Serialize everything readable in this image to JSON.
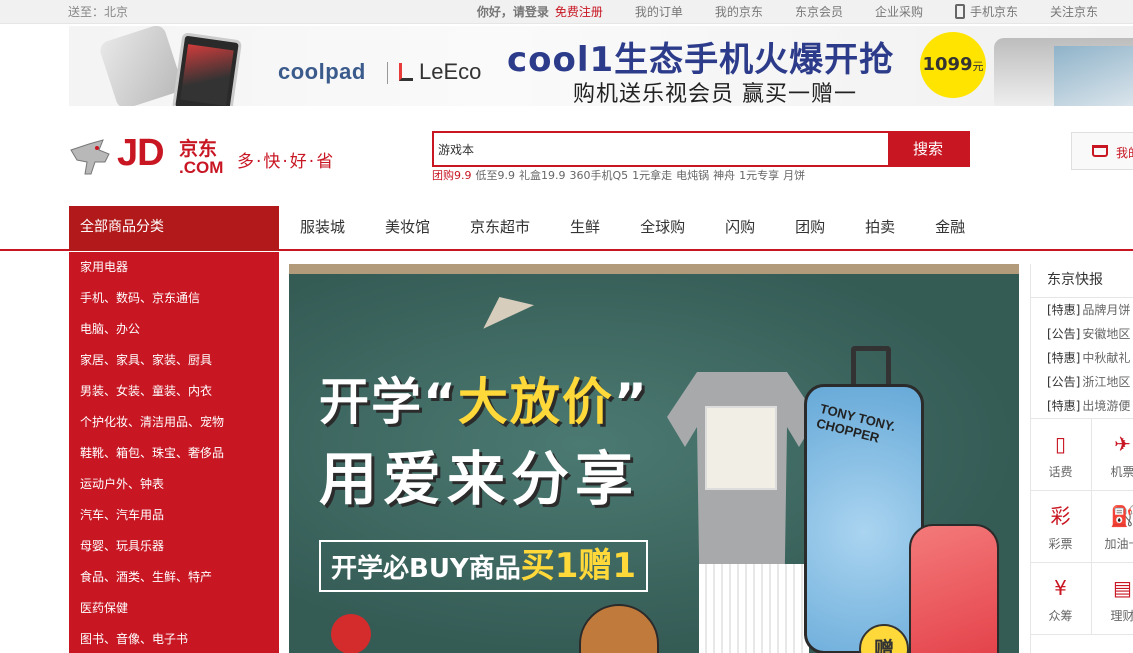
{
  "topbar": {
    "location_label": "送至：北京",
    "greeting": "你好，请登录",
    "register": "免费注册",
    "my_orders": "我的订单",
    "my_jd": "我的京东",
    "member": "东京会员",
    "enterprise": "企业采购",
    "mobile": "手机京东",
    "follow": "关注京东"
  },
  "banner": {
    "brand1": "coolpad",
    "brand2": "LeEco",
    "headline": "cool1生态手机火爆开抢",
    "subline": "购机送乐视会员 赢买一赠一",
    "price": "1099",
    "price_unit": "元"
  },
  "logo": {
    "jd": "JD",
    "cn": "京东",
    "com": ".COM",
    "slogan": "多·快·好·省"
  },
  "search": {
    "value": "游戏本",
    "button": "搜索",
    "hotwords": [
      "团购9.9",
      "低至9.9",
      "礼盒19.9",
      "360手机Q5",
      "1元拿走",
      "电炖锅",
      "神舟",
      "1元专享",
      "月饼"
    ]
  },
  "cart": {
    "label": "我的"
  },
  "nav": {
    "all_categories": "全部商品分类",
    "items": [
      "服装城",
      "美妆馆",
      "京东超市",
      "生鲜",
      "全球购",
      "闪购",
      "团购",
      "拍卖",
      "金融"
    ]
  },
  "categories": [
    "家用电器",
    "手机、数码、京东通信",
    "电脑、办公",
    "家居、家具、家装、厨具",
    "男装、女装、童装、内衣",
    "个护化妆、清洁用品、宠物",
    "鞋靴、箱包、珠宝、奢侈品",
    "运动户外、钟表",
    "汽车、汽车用品",
    "母婴、玩具乐器",
    "食品、酒类、生鲜、特产",
    "医药保健",
    "图书、音像、电子书"
  ],
  "slide": {
    "line1_a": "开学“",
    "line1_b": "大放价",
    "line1_c": "”",
    "line2": "用爱来分享",
    "promo_a": "开学必BUY商品",
    "promo_b": "买1赠1",
    "luggage_label": "TONY TONY. CHOPPER",
    "gift": "赠"
  },
  "news": {
    "title": "东京快报",
    "items": [
      {
        "tag": "[特惠]",
        "text": "品牌月饼"
      },
      {
        "tag": "[公告]",
        "text": "安徽地区"
      },
      {
        "tag": "[特惠]",
        "text": "中秋献礼"
      },
      {
        "tag": "[公告]",
        "text": "浙江地区"
      },
      {
        "tag": "[特惠]",
        "text": "出境游便"
      }
    ]
  },
  "services": [
    {
      "icon": "phone-bill-icon",
      "glyph": "▯",
      "label": "话费"
    },
    {
      "icon": "plane-icon",
      "glyph": "✈",
      "label": "机票"
    },
    {
      "icon": "lottery-icon",
      "glyph": "彩",
      "label": "彩票"
    },
    {
      "icon": "fuel-icon",
      "glyph": "⛽",
      "label": "加油卡"
    },
    {
      "icon": "crowdfund-icon",
      "glyph": "¥",
      "label": "众筹"
    },
    {
      "icon": "finance-icon",
      "glyph": "▤",
      "label": "理财"
    }
  ],
  "colors": {
    "brand_red": "#c81623",
    "nav_dark_red": "#b1191a",
    "chalkboard": "#3c6660"
  }
}
